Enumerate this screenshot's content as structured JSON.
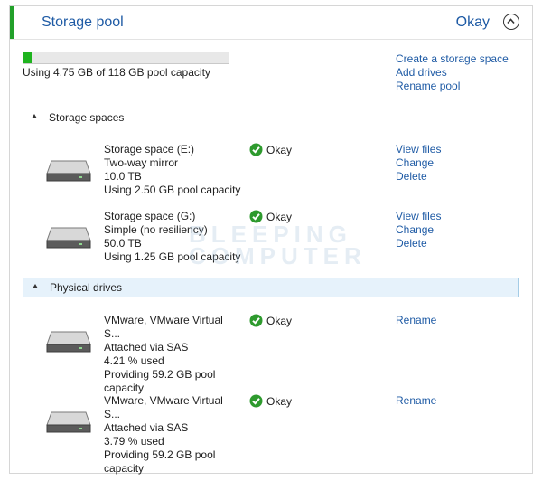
{
  "header": {
    "title": "Storage pool",
    "status": "Okay"
  },
  "capacity": {
    "used_fraction": 0.0403,
    "text": "Using 4.75 GB of 118 GB pool capacity"
  },
  "pool_actions": [
    "Create a storage space",
    "Add drives",
    "Rename pool"
  ],
  "sections": {
    "spaces": "Storage spaces",
    "drives": "Physical drives"
  },
  "storage_spaces": [
    {
      "name": "Storage space (E:)",
      "type": "Two-way mirror",
      "size": "10.0 TB",
      "usage": "Using 2.50 GB pool capacity",
      "status": "Okay",
      "actions": [
        "View files",
        "Change",
        "Delete"
      ]
    },
    {
      "name": "Storage space (G:)",
      "type": "Simple (no resiliency)",
      "size": "50.0 TB",
      "usage": "Using 1.25 GB pool capacity",
      "status": "Okay",
      "actions": [
        "View files",
        "Change",
        "Delete"
      ]
    }
  ],
  "physical_drives": [
    {
      "name": "VMware, VMware Virtual S...",
      "connection": "Attached via SAS",
      "used": "4.21 % used",
      "providing1": "Providing 59.2 GB pool",
      "providing2": "capacity",
      "status": "Okay",
      "action": "Rename"
    },
    {
      "name": "VMware, VMware Virtual S...",
      "connection": "Attached via SAS",
      "used": "3.79 % used",
      "providing1": "Providing 59.2 GB pool",
      "providing2": "capacity",
      "status": "Okay",
      "action": "Rename"
    }
  ],
  "watermark": [
    "BLEEPING",
    "COMPUTER"
  ],
  "colors": {
    "accent": "#22a02a",
    "link": "#1f5ba5",
    "ok": "#2e9a2e",
    "bar_fill": "#1fb41f"
  },
  "icons": {
    "collapse": "chevron-up-icon",
    "status": "check-circle-icon",
    "drive": "hard-drive-icon"
  }
}
